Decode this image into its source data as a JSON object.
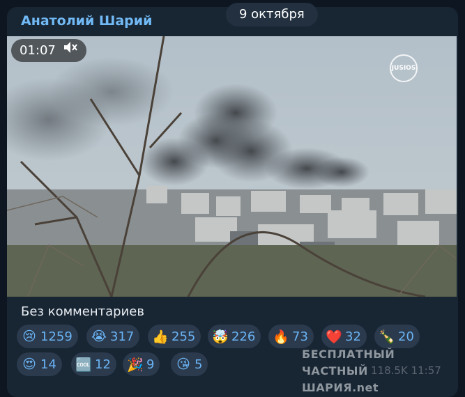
{
  "channel": {
    "name": "Анатолий Шарий"
  },
  "date_pill": "9 октября",
  "media": {
    "duration": "01:07",
    "watermark": "JUSIOS"
  },
  "caption": "Без комментариев",
  "reactions": [
    {
      "emoji": "😢",
      "count": "1259"
    },
    {
      "emoji": "😭",
      "count": "317"
    },
    {
      "emoji": "👍",
      "count": "255"
    },
    {
      "emoji": "🤯",
      "count": "226"
    },
    {
      "emoji": "🔥",
      "count": "73"
    },
    {
      "emoji": "❤️",
      "count": "32"
    },
    {
      "emoji": "🍾",
      "count": "20"
    },
    {
      "emoji": "😍",
      "count": "14"
    },
    {
      "emoji": "🆒",
      "count": "12"
    },
    {
      "emoji": "🎉",
      "count": "9"
    },
    {
      "emoji": "😘",
      "count": "5"
    }
  ],
  "footer_watermark": {
    "line1": "БЕСПЛАТНЫЙ ЧАСТНЫЙ",
    "line2": "ШАРИЯ.net"
  },
  "meta": {
    "views": "118.5K",
    "time": "11:57"
  },
  "colors": {
    "background": "#0e1621",
    "bubble": "#182533",
    "accent": "#71baf5",
    "reaction_bg": "#2b3a4d"
  }
}
